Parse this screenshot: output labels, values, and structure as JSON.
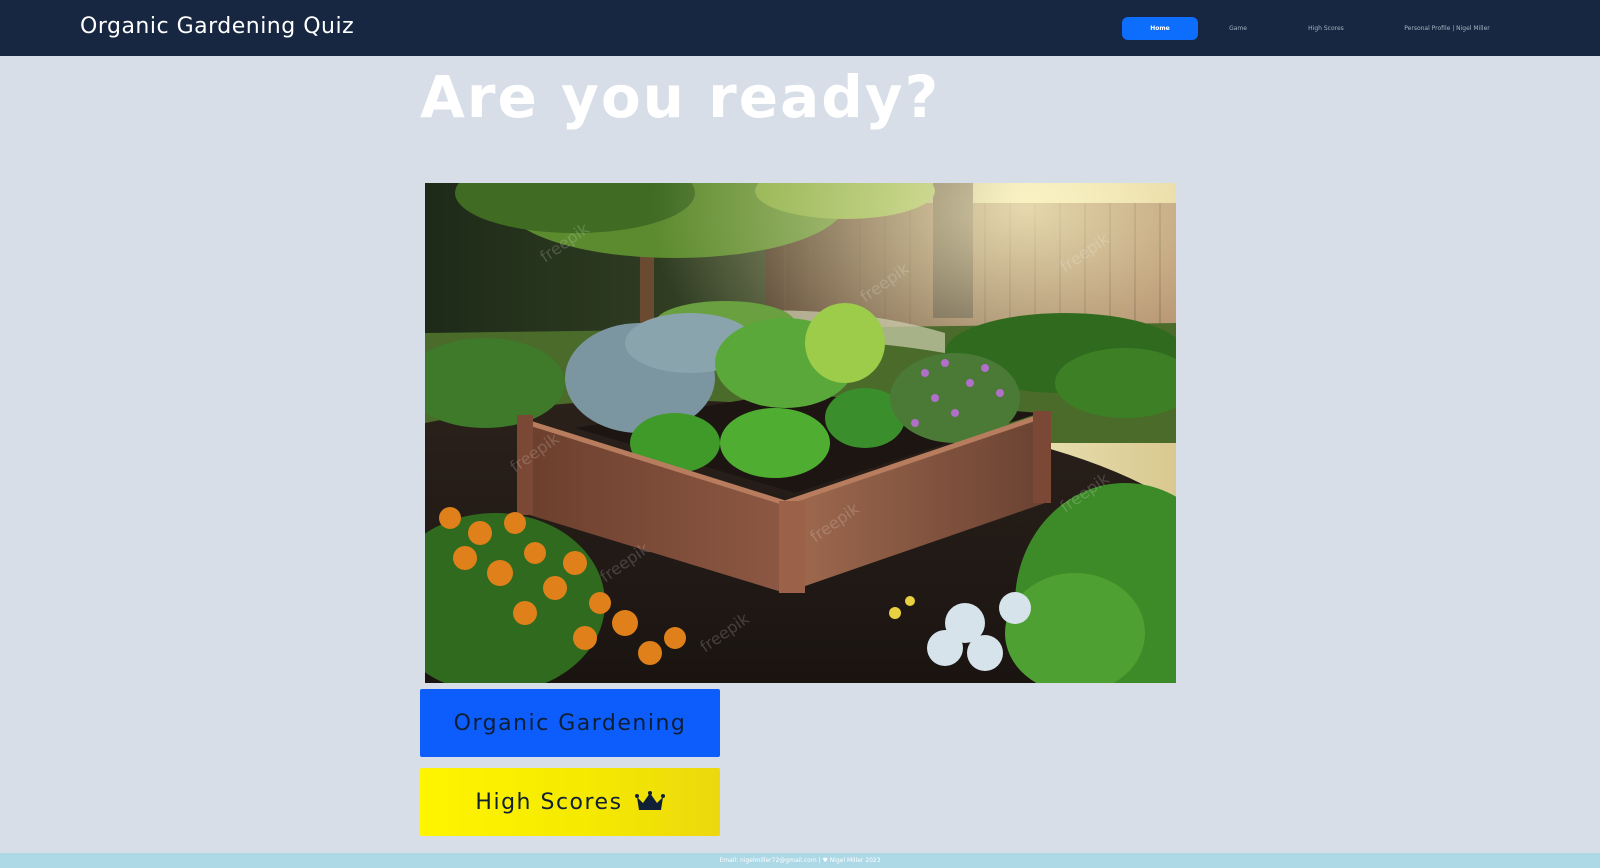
{
  "navbar": {
    "brand": "Organic Gardening Quiz",
    "links": [
      {
        "label": "Home",
        "active": true
      },
      {
        "label": "Game",
        "active": false
      },
      {
        "label": "High Scores",
        "active": false
      },
      {
        "label": "Personal Profile | Nigel Miller",
        "active": false
      }
    ]
  },
  "hero": {
    "title": "Are you ready?"
  },
  "image": {
    "watermark": "freepik"
  },
  "buttons": {
    "quiz_label": "Organic Gardening",
    "scores_label": "High Scores",
    "scores_icon": "crown-icon"
  },
  "footer": {
    "text": "Email: nigelmiller72@gmail.com | ♥ Nigel Miller 2023"
  },
  "colors": {
    "navbar_bg": "#172741",
    "page_bg": "#d7dee7",
    "active_link": "#0d6efd",
    "quiz_button": "#0d5dfd",
    "scores_button": "#fff500",
    "footer_bg": "#add8e6"
  }
}
